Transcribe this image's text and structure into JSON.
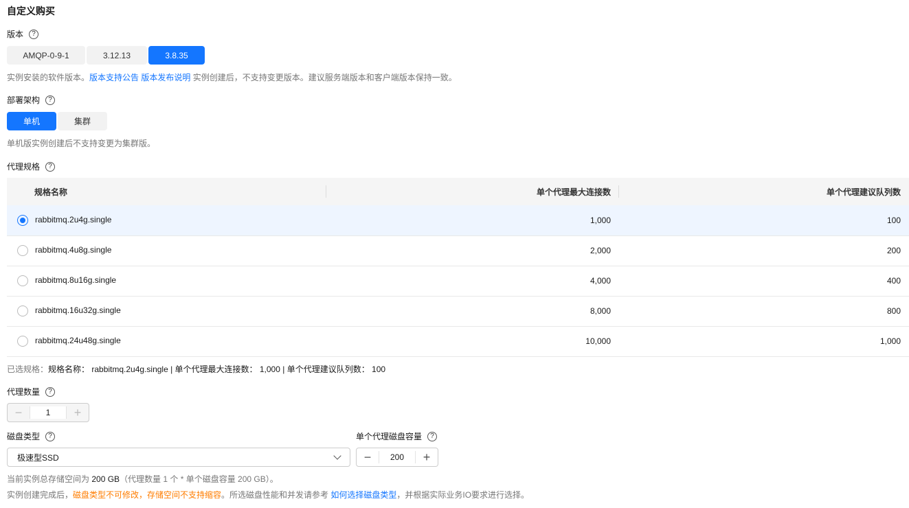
{
  "title": "自定义购买",
  "version": {
    "label": "版本",
    "options": [
      "AMQP-0-9-1",
      "3.12.13",
      "3.8.35"
    ],
    "selected": "3.8.35",
    "hint_prefix": "实例安装的软件版本。",
    "link1": "版本支持公告",
    "link2": "版本发布说明",
    "hint_suffix": " 实例创建后，不支持变更版本。建议服务端版本和客户端版本保持一致。"
  },
  "arch": {
    "label": "部署架构",
    "options": [
      "单机",
      "集群"
    ],
    "selected": "单机",
    "hint": "单机版实例创建后不支持变更为集群版。"
  },
  "spec": {
    "label": "代理规格",
    "columns": [
      "规格名称",
      "单个代理最大连接数",
      "单个代理建议队列数"
    ],
    "rows": [
      [
        "rabbitmq.2u4g.single",
        "1,000",
        "100"
      ],
      [
        "rabbitmq.4u8g.single",
        "2,000",
        "200"
      ],
      [
        "rabbitmq.8u16g.single",
        "4,000",
        "400"
      ],
      [
        "rabbitmq.16u32g.single",
        "8,000",
        "800"
      ],
      [
        "rabbitmq.24u48g.single",
        "10,000",
        "1,000"
      ]
    ],
    "selected_index": 0,
    "summary_label": "已选规格：",
    "summary": "规格名称： rabbitmq.2u4g.single | 单个代理最大连接数： 1,000 | 单个代理建议队列数： 100"
  },
  "brokers": {
    "label": "代理数量",
    "value": "1",
    "minus": "−",
    "plus": "+"
  },
  "disk": {
    "type_label": "磁盘类型",
    "type_value": "极速型SSD",
    "cap_label": "单个代理磁盘容量",
    "cap_value": "200",
    "total_a": "当前实例总存储空间为 ",
    "total_b": "200 GB",
    "total_c": "（代理数量 1 个 * 单个磁盘容量 200 GB）。",
    "note_a": "实例创建完成后，",
    "note_warn": "磁盘类型不可修改，存储空间不支持缩容",
    "note_b": "。所选磁盘性能和并发请参考 ",
    "note_link": "如何选择磁盘类型",
    "note_c": "，并根据实际业务IO要求进行选择。"
  },
  "help_glyph": "?"
}
